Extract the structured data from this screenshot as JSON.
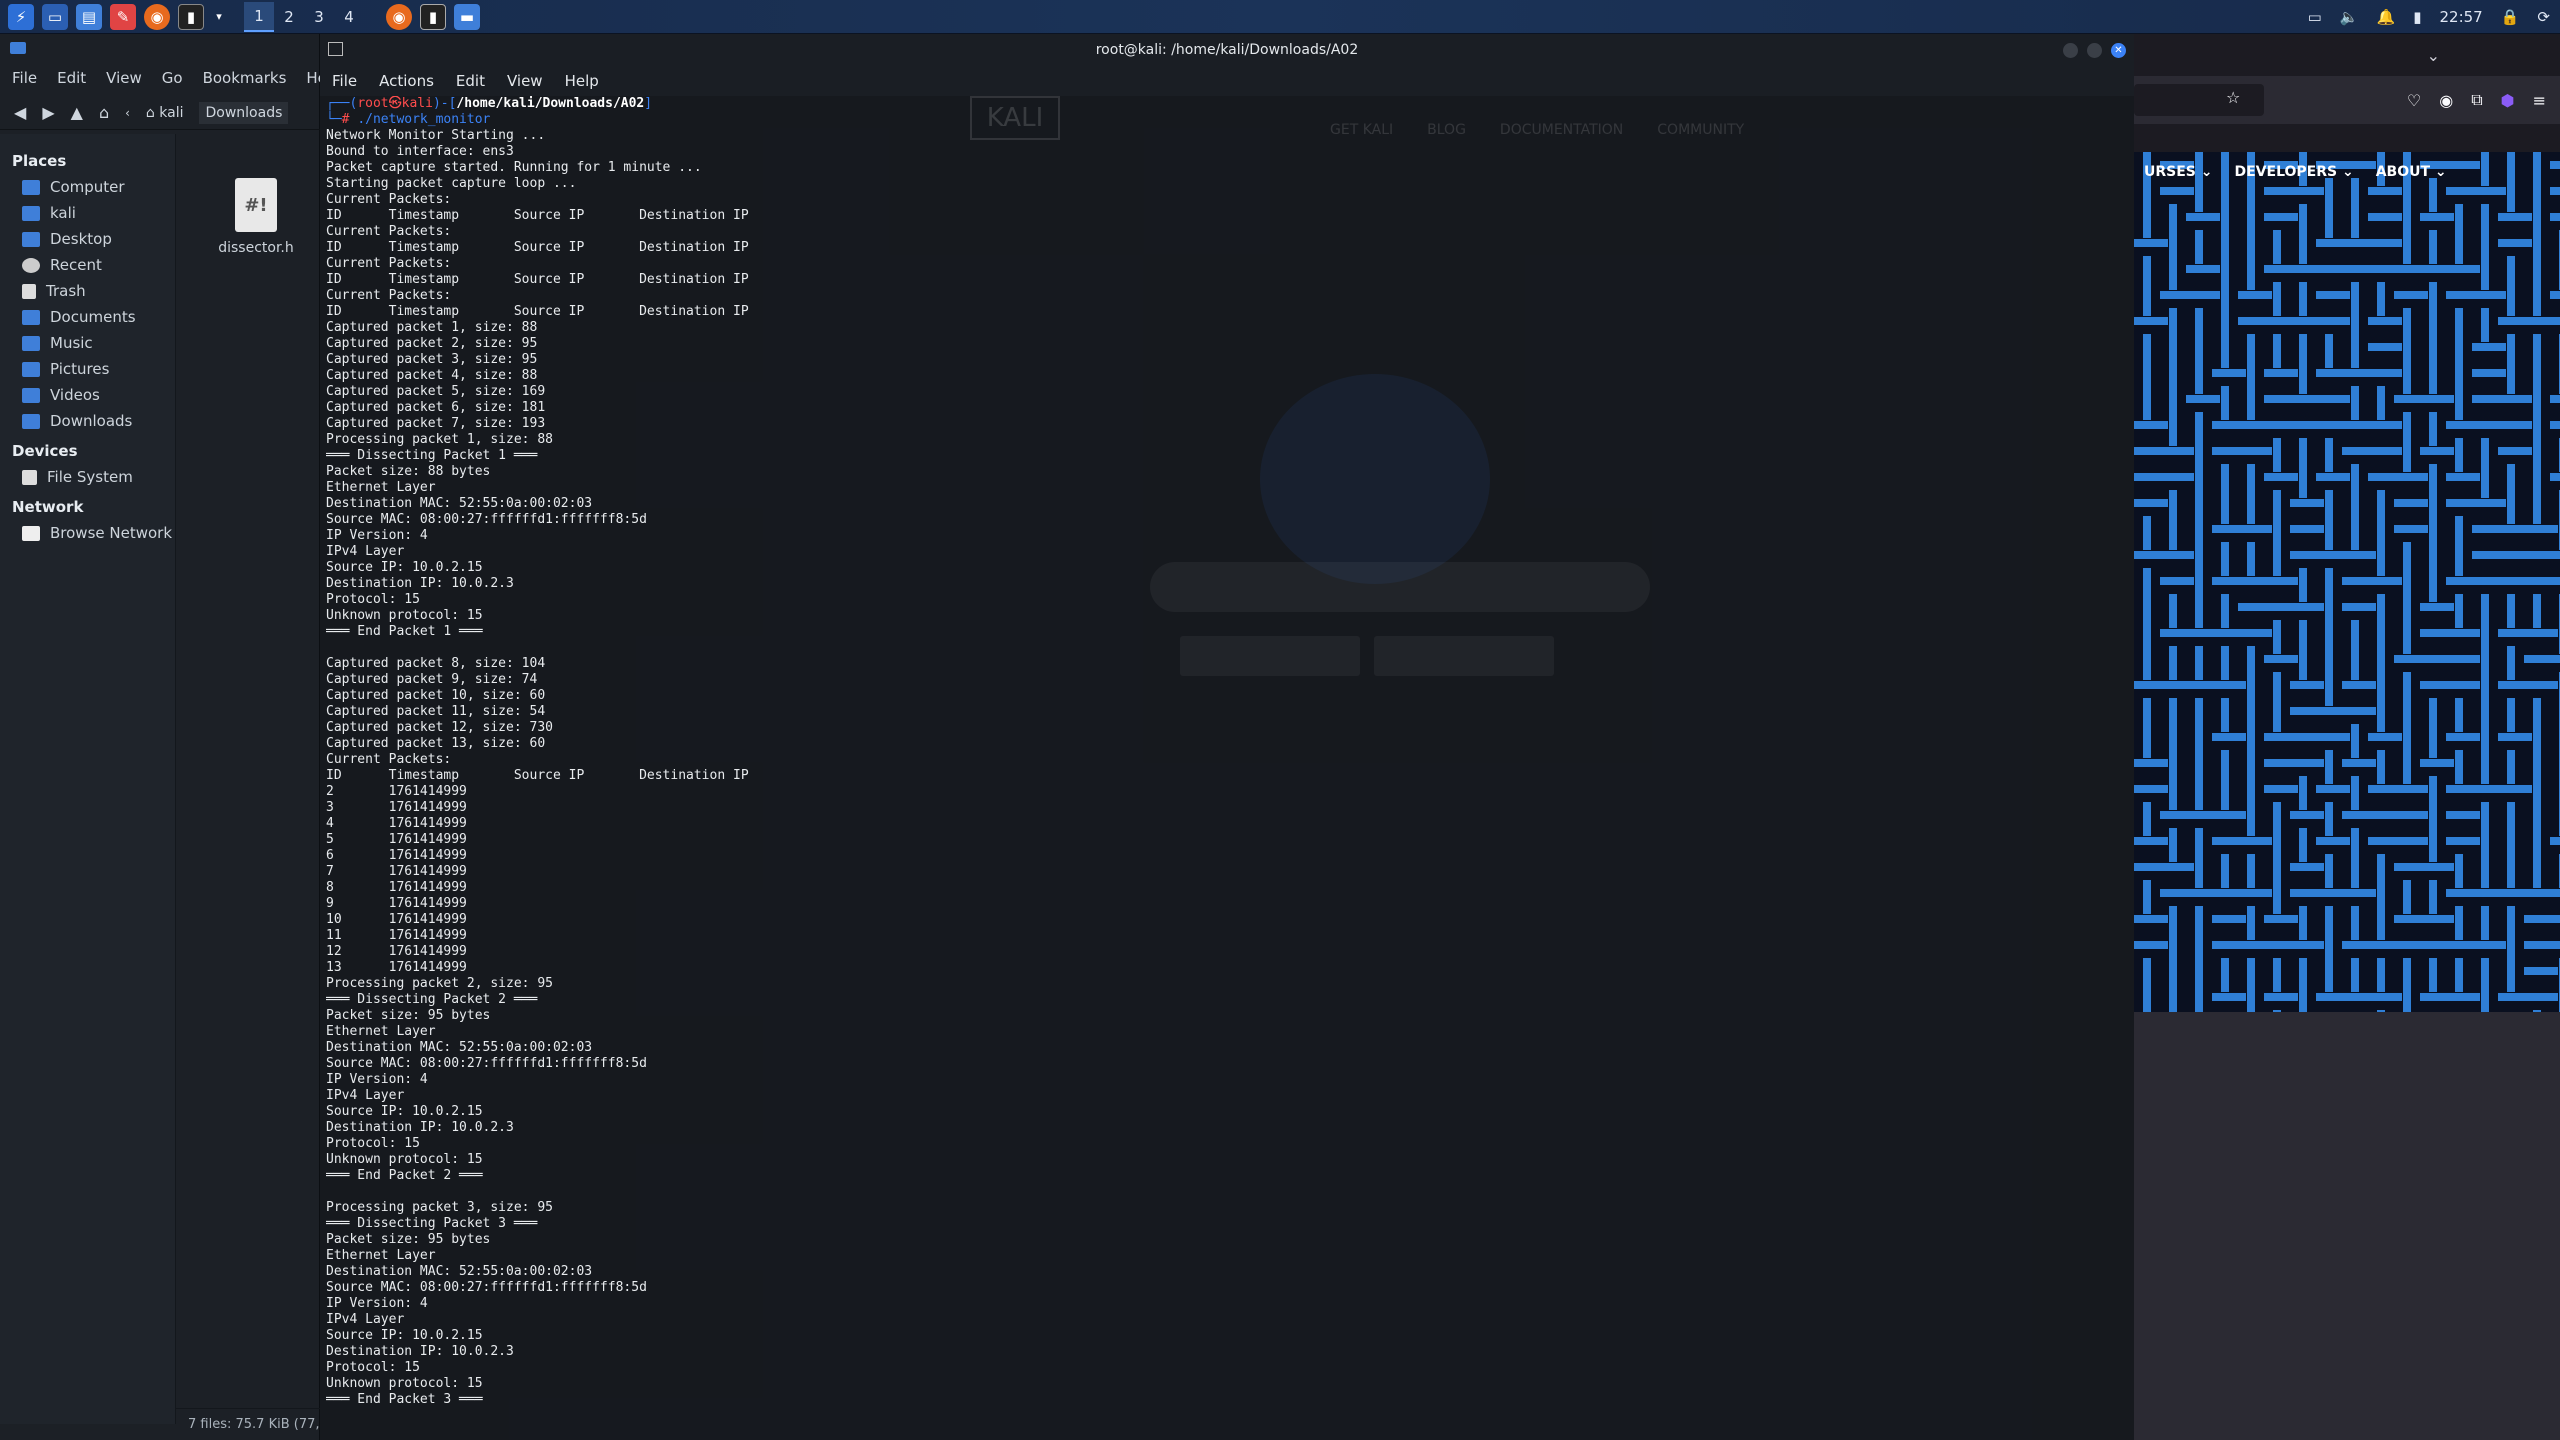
{
  "taskbar": {
    "workspaces": [
      "1",
      "2",
      "3",
      "4"
    ],
    "clock": "22:57"
  },
  "file_manager": {
    "menu": [
      "File",
      "Edit",
      "View",
      "Go",
      "Bookmarks",
      "Help"
    ],
    "path": [
      "kali",
      "Downloads"
    ],
    "places_heading": "Places",
    "places": [
      "Computer",
      "kali",
      "Desktop",
      "Recent",
      "Trash",
      "Documents",
      "Music",
      "Pictures",
      "Videos",
      "Downloads"
    ],
    "devices_heading": "Devices",
    "devices": [
      "File System"
    ],
    "network_heading": "Network",
    "network": [
      "Browse Network"
    ],
    "file_name": "dissector.h",
    "file_icon_text": "#!",
    "status": "7 files: 75.7 KiB (77,"
  },
  "terminal": {
    "title": "root@kali: /home/kali/Downloads/A02",
    "menu": [
      "File",
      "Actions",
      "Edit",
      "View",
      "Help"
    ],
    "prompt_user": "root㉿kali",
    "prompt_path": "/home/kali/Downloads/A02",
    "command": "./network_monitor",
    "lines": [
      "Network Monitor Starting ...",
      "Bound to interface: ens3",
      "Packet capture started. Running for 1 minute ...",
      "Starting packet capture loop ...",
      "Current Packets:",
      "ID      Timestamp       Source IP       Destination IP",
      "Current Packets:",
      "ID      Timestamp       Source IP       Destination IP",
      "Current Packets:",
      "ID      Timestamp       Source IP       Destination IP",
      "Current Packets:",
      "ID      Timestamp       Source IP       Destination IP",
      "Captured packet 1, size: 88",
      "Captured packet 2, size: 95",
      "Captured packet 3, size: 95",
      "Captured packet 4, size: 88",
      "Captured packet 5, size: 169",
      "Captured packet 6, size: 181",
      "Captured packet 7, size: 193",
      "Processing packet 1, size: 88",
      "═══ Dissecting Packet 1 ═══",
      "Packet size: 88 bytes",
      "Ethernet Layer",
      "Destination MAC: 52:55:0a:00:02:03",
      "Source MAC: 08:00:27:ffffffd1:fffffff8:5d",
      "IP Version: 4",
      "IPv4 Layer",
      "Source IP: 10.0.2.15",
      "Destination IP: 10.0.2.3",
      "Protocol: 15",
      "Unknown protocol: 15",
      "═══ End Packet 1 ═══",
      "",
      "Captured packet 8, size: 104",
      "Captured packet 9, size: 74",
      "Captured packet 10, size: 60",
      "Captured packet 11, size: 54",
      "Captured packet 12, size: 730",
      "Captured packet 13, size: 60",
      "Current Packets:",
      "ID      Timestamp       Source IP       Destination IP",
      "2       1761414999",
      "3       1761414999",
      "4       1761414999",
      "5       1761414999",
      "6       1761414999",
      "7       1761414999",
      "8       1761414999",
      "9       1761414999",
      "10      1761414999",
      "11      1761414999",
      "12      1761414999",
      "13      1761414999",
      "Processing packet 2, size: 95",
      "═══ Dissecting Packet 2 ═══",
      "Packet size: 95 bytes",
      "Ethernet Layer",
      "Destination MAC: 52:55:0a:00:02:03",
      "Source MAC: 08:00:27:ffffffd1:fffffff8:5d",
      "IP Version: 4",
      "IPv4 Layer",
      "Source IP: 10.0.2.15",
      "Destination IP: 10.0.2.3",
      "Protocol: 15",
      "Unknown protocol: 15",
      "═══ End Packet 2 ═══",
      "",
      "Processing packet 3, size: 95",
      "═══ Dissecting Packet 3 ═══",
      "Packet size: 95 bytes",
      "Ethernet Layer",
      "Destination MAC: 52:55:0a:00:02:03",
      "Source MAC: 08:00:27:ffffffd1:fffffff8:5d",
      "IP Version: 4",
      "IPv4 Layer",
      "Source IP: 10.0.2.15",
      "Destination IP: 10.0.2.3",
      "Protocol: 15",
      "Unknown protocol: 15",
      "═══ End Packet 3 ═══"
    ]
  },
  "background_page": {
    "logo": "KALI",
    "nav": [
      "GET KALI",
      "BLOG",
      "DOCUMENTATION",
      "COMMUNITY"
    ]
  },
  "firefox": {
    "nav": [
      "URSES",
      "DEVELOPERS",
      "ABOUT"
    ]
  },
  "colors": {
    "maze_blue": "#2f7fd6",
    "prompt_blue": "#3b82f6",
    "prompt_red": "#ff4d4d"
  }
}
